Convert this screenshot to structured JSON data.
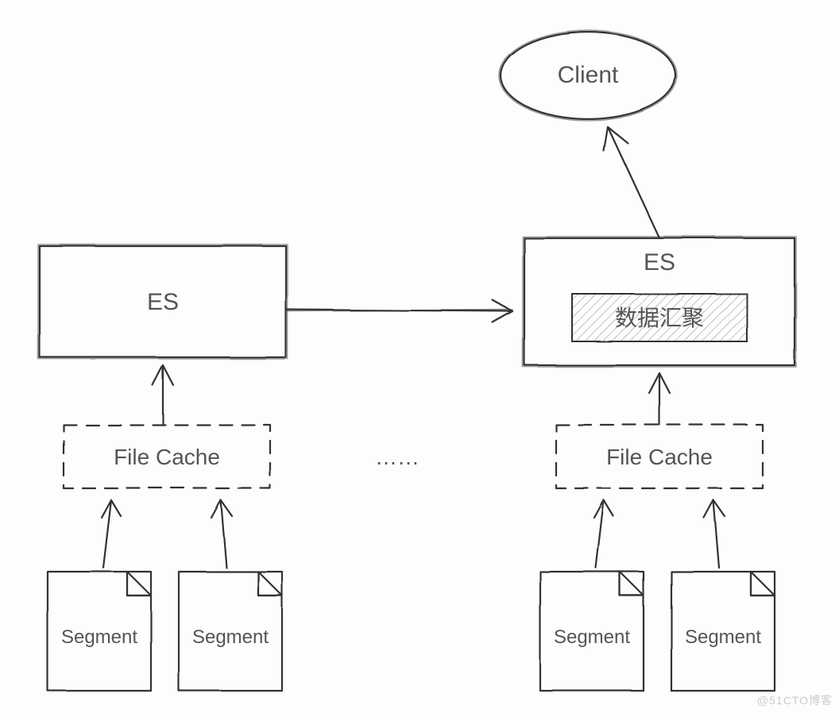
{
  "diagram": {
    "client": "Client",
    "left_es": "ES",
    "right_es": "ES",
    "aggregator": "数据汇聚",
    "file_cache_left": "File Cache",
    "file_cache_right": "File Cache",
    "ellipsis": "……",
    "segment_a1": "Segment",
    "segment_a2": "Segment",
    "segment_b1": "Segment",
    "segment_b2": "Segment",
    "watermark": "@51CTO博客"
  }
}
